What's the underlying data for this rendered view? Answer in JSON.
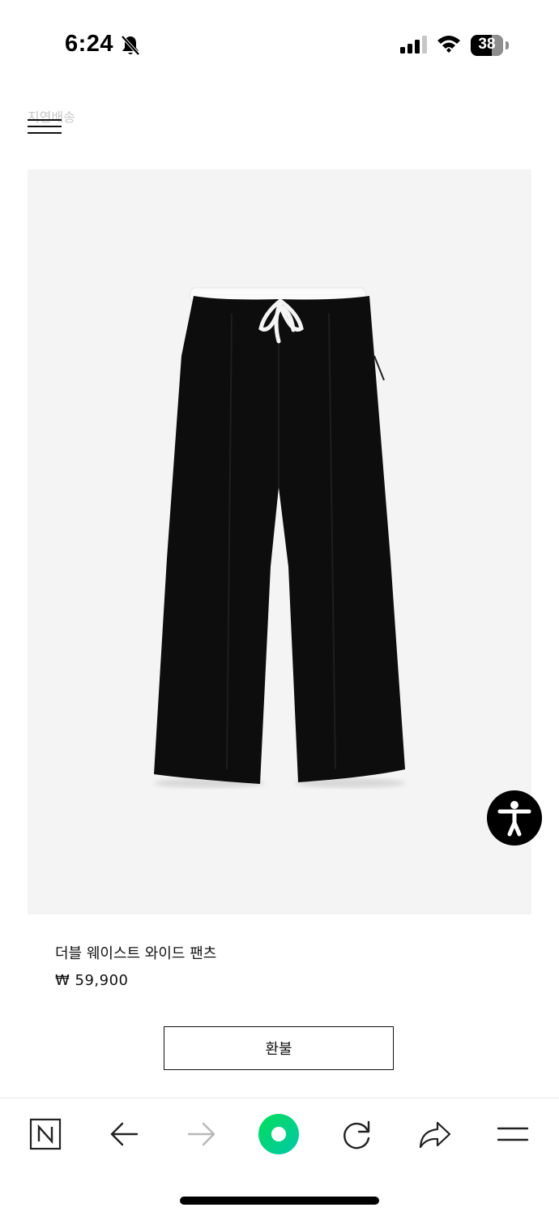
{
  "status_bar": {
    "time": "6:24",
    "battery_level": "38"
  },
  "header": {
    "ghost_text": "지연배송"
  },
  "product": {
    "name": "더블 웨이스트 와이드 팬츠",
    "price": "₩ 59,900",
    "image_icon": "black-wide-pants-image"
  },
  "actions": {
    "refund_label": "환불"
  },
  "icons": {
    "accessibility": "accessibility-icon",
    "naver": "naver-icon",
    "back": "back-arrow-icon",
    "forward": "forward-arrow-icon",
    "home": "green-home-icon",
    "reload": "reload-icon",
    "share": "share-icon",
    "menu": "menu-icon"
  },
  "colors": {
    "accent_green": "#03c75a",
    "background": "#ffffff",
    "image_bg": "#f4f4f4"
  }
}
